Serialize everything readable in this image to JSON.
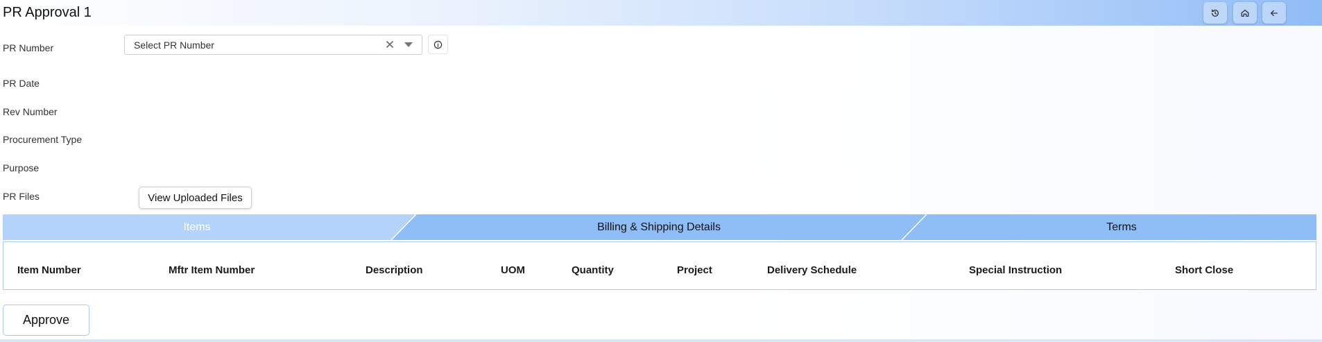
{
  "header": {
    "title": "PR Approval 1",
    "buttons": [
      {
        "icon": "history-icon"
      },
      {
        "icon": "home-icon"
      },
      {
        "icon": "arrow-left-icon"
      }
    ]
  },
  "form": {
    "fields": [
      {
        "label": "PR Number"
      },
      {
        "label": "PR Date"
      },
      {
        "label": "Rev Number"
      },
      {
        "label": "Procurement Type"
      },
      {
        "label": "Purpose"
      },
      {
        "label": "PR Files"
      }
    ],
    "pr_number_select": {
      "placeholder": "Select PR Number"
    },
    "files_button_label": "View Uploaded Files"
  },
  "tabs": [
    {
      "label": "Items",
      "active": true
    },
    {
      "label": "Billing & Shipping Details",
      "active": false
    },
    {
      "label": "Terms",
      "active": false
    }
  ],
  "table": {
    "columns": [
      "Item Number",
      "Mftr Item Number",
      "Description",
      "UOM",
      "Quantity",
      "Project",
      "Delivery Schedule",
      "Special Instruction",
      "Short Close"
    ]
  },
  "actions": {
    "approve_label": "Approve"
  },
  "colors": {
    "header_gradient_end": "#90bcf6",
    "tab_active": "#b3d3fa",
    "tab_inactive": "#8fbdf6",
    "active_tab_text": "#ffffff",
    "border_accent": "#a8cbf0"
  }
}
